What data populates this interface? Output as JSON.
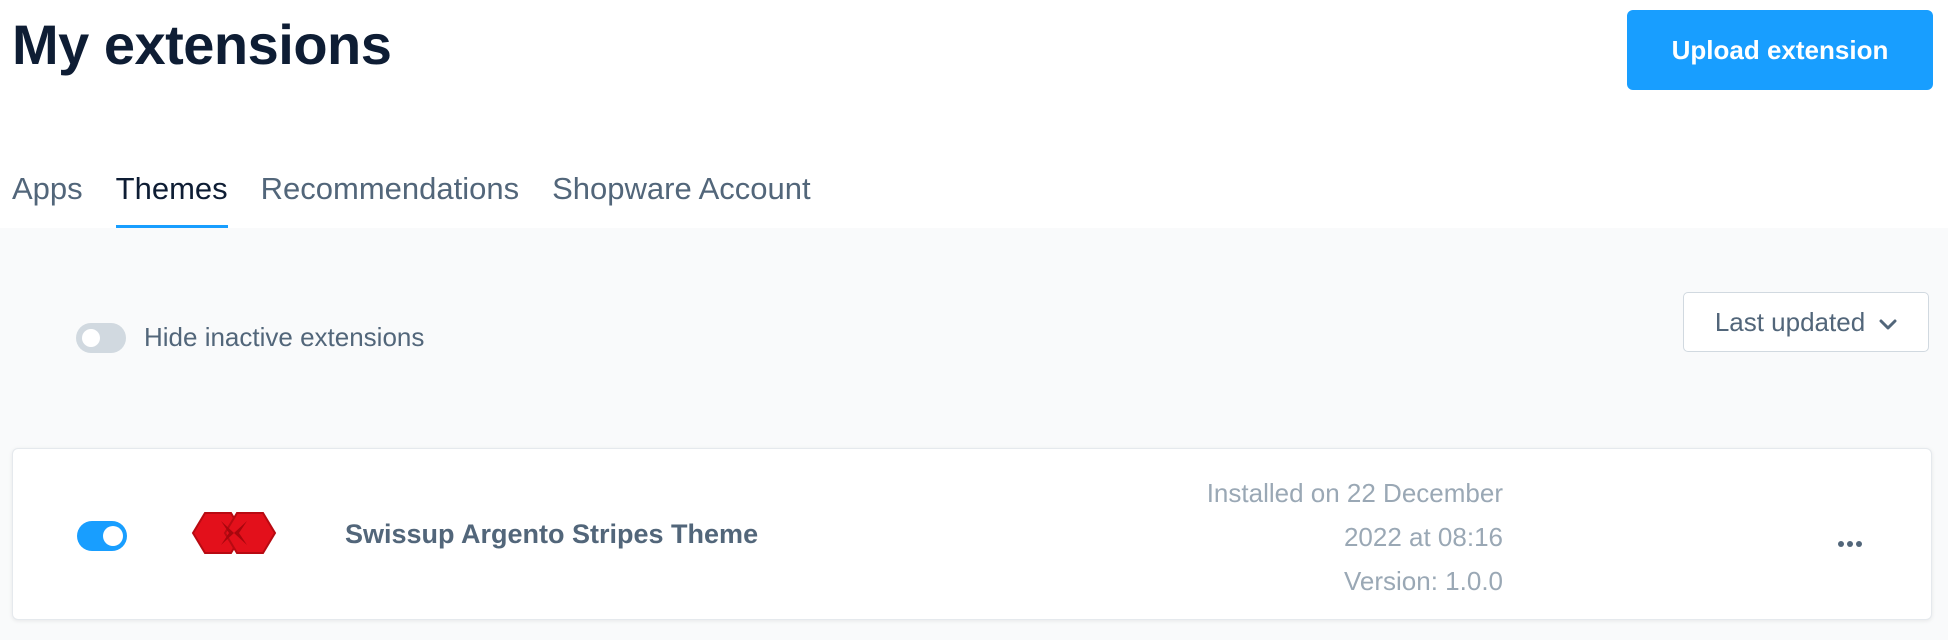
{
  "header": {
    "title": "My extensions",
    "upload_label": "Upload extension"
  },
  "tabs": [
    {
      "label": "Apps",
      "active": false
    },
    {
      "label": "Themes",
      "active": true
    },
    {
      "label": "Recommendations",
      "active": false
    },
    {
      "label": "Shopware Account",
      "active": false
    }
  ],
  "filters": {
    "hide_inactive_label": "Hide inactive extensions",
    "hide_inactive_enabled": false,
    "sort_label": "Last updated",
    "sort_icon": "chevron-down-icon"
  },
  "extensions": [
    {
      "name": "Swissup Argento Stripes Theme",
      "active": true,
      "installed_line1": "Installed on 22 December",
      "installed_line2": "2022 at 08:16",
      "version": "Version: 1.0.0",
      "logo_icon": "swissup-logo-icon",
      "menu_icon": "more-options-icon"
    }
  ],
  "colors": {
    "accent": "#189eff",
    "title": "#0e1d34",
    "text": "#52667a",
    "muted": "#9aa8b5",
    "logo_red": "#e3101b",
    "toggle_off": "#d1d9e0",
    "content_bg": "#f9fafb"
  }
}
